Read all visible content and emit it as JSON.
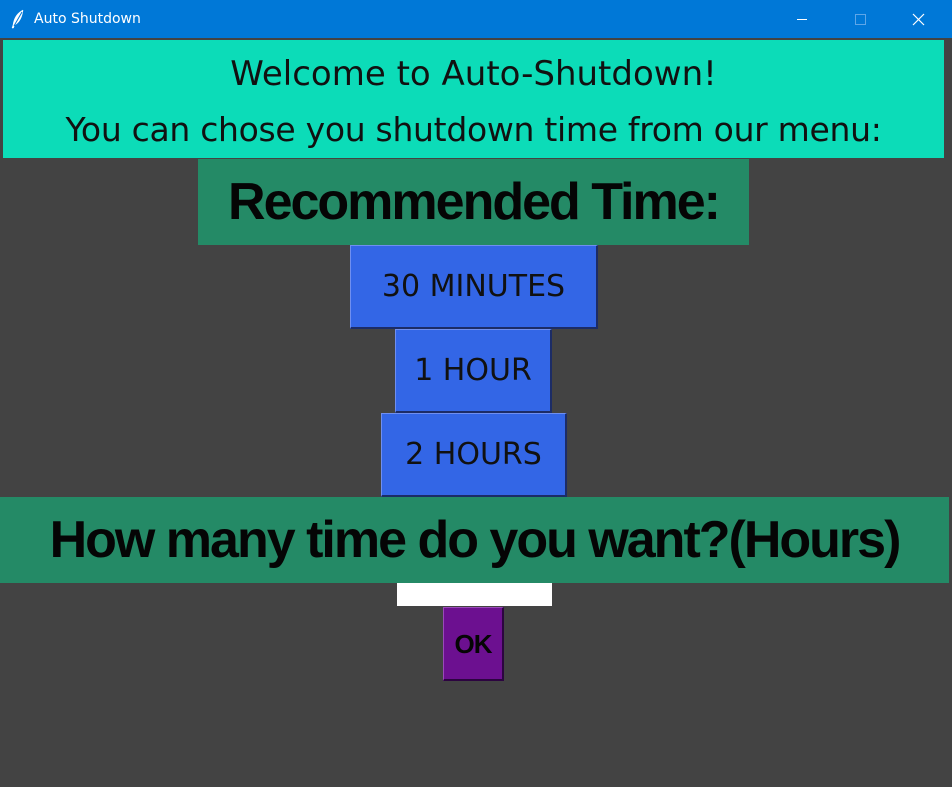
{
  "window": {
    "title": "Auto Shutdown",
    "icon": "feather-icon",
    "controls": [
      "minimize-icon",
      "maximize-icon",
      "close-icon"
    ]
  },
  "welcome": {
    "line1": "Welcome to Auto-Shutdown!",
    "line2": "You can chose you shutdown time from our menu:"
  },
  "recommended": {
    "heading": "Recommended Time:",
    "options": [
      {
        "label": "30 MINUTES"
      },
      {
        "label": "1 HOUR"
      },
      {
        "label": "2 HOURS"
      }
    ]
  },
  "custom": {
    "heading": "How many time do you want?(Hours)",
    "input_value": "",
    "ok_label": "OK"
  },
  "colors": {
    "titlebar": "#0078d7",
    "background": "#434343",
    "welcome_panel": "#0cdcb8",
    "banner": "#248a66",
    "option_button": "#3366e6",
    "ok_button": "#6c1090"
  }
}
